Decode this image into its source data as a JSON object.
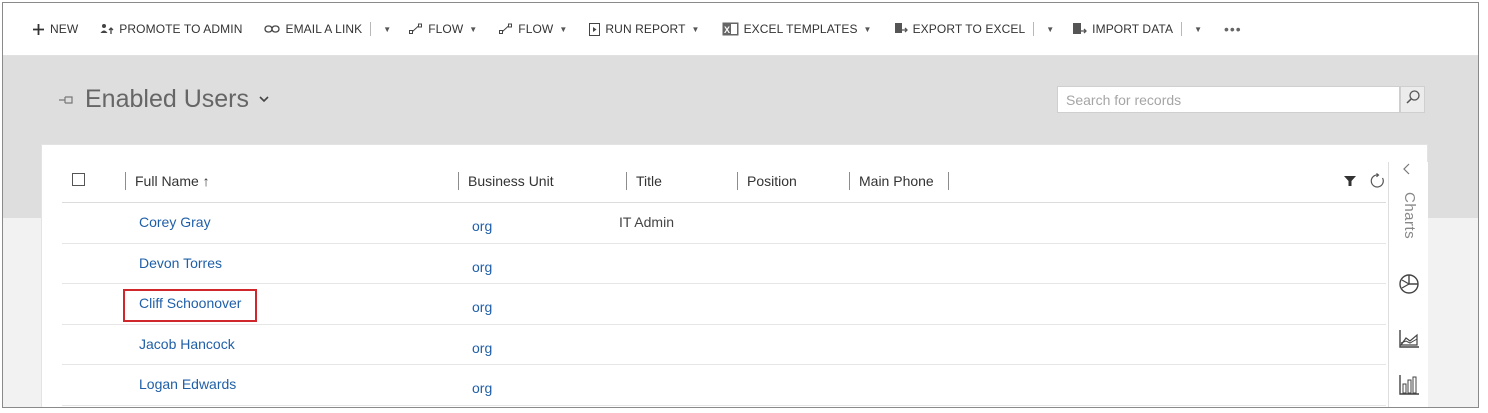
{
  "commandbar": {
    "new": "NEW",
    "promote": "PROMOTE TO ADMIN",
    "email_link": "EMAIL A LINK",
    "flow1": "FLOW",
    "flow2": "FLOW",
    "run_report": "RUN REPORT",
    "excel_templates": "EXCEL TEMPLATES",
    "export_excel": "EXPORT TO EXCEL",
    "import_data": "IMPORT DATA",
    "more": "•••"
  },
  "view": {
    "title": "Enabled Users"
  },
  "search": {
    "placeholder": "Search for records"
  },
  "grid": {
    "columns": {
      "full_name": "Full Name ↑",
      "business_unit": "Business Unit",
      "title": "Title",
      "position": "Position",
      "main_phone": "Main Phone"
    },
    "rows": [
      {
        "name": "Corey Gray",
        "business_unit": "org",
        "title": "IT Admin"
      },
      {
        "name": "Devon Torres",
        "business_unit": "org",
        "title": ""
      },
      {
        "name": "Cliff Schoonover",
        "business_unit": "org",
        "title": ""
      },
      {
        "name": "Jacob Hancock",
        "business_unit": "org",
        "title": ""
      },
      {
        "name": "Logan Edwards",
        "business_unit": "org",
        "title": ""
      }
    ],
    "highlighted_row": "Cliff Schoonover"
  },
  "charts_rail": {
    "label": "Charts"
  },
  "colors": {
    "link": "#1f5fa8",
    "highlight": "#d0272c",
    "band": "#dedede"
  },
  "icons": [
    "plus-icon",
    "promote-icon",
    "link-icon",
    "flow-icon",
    "report-icon",
    "excel-icon",
    "export-icon",
    "import-icon",
    "pin-icon",
    "search-icon",
    "filter-icon",
    "refresh-icon",
    "pie-chart-icon",
    "area-chart-icon",
    "bar-chart-icon"
  ]
}
